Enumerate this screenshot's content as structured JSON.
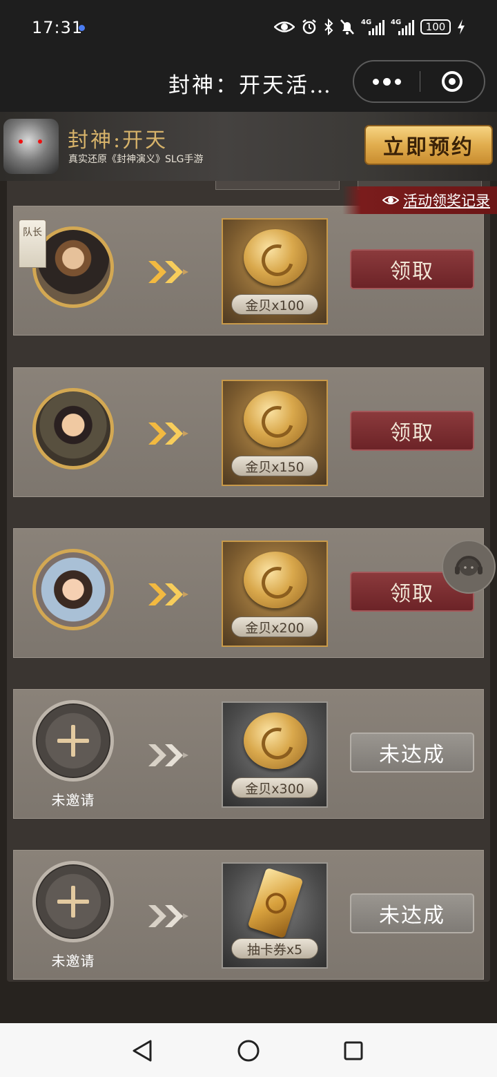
{
  "status_bar": {
    "time": "17:31",
    "icons": [
      "eye-icon",
      "alarm-icon",
      "bluetooth-icon",
      "mute-icon",
      "signal-4g-icon",
      "signal-4g-icon",
      "battery-icon",
      "charging-icon"
    ],
    "network_1": "4G",
    "network_2": "4G",
    "battery": "100"
  },
  "title_bar": {
    "title": "封神：开天活…"
  },
  "banner": {
    "game_title": "封神:开天",
    "subtitle": "真实还原《封神演义》SLG手游",
    "reserve_button": "立即预约"
  },
  "record_link": "活动领奖记录",
  "rows": [
    {
      "slot": "captain",
      "captain_badge": "队长",
      "reward": "金贝x100",
      "reward_icon": "gold-coin-icon",
      "button": "领取",
      "state": "claimable"
    },
    {
      "slot": "friend",
      "reward": "金贝x150",
      "reward_icon": "gold-coin-icon",
      "button": "领取",
      "state": "claimable"
    },
    {
      "slot": "friend",
      "reward": "金贝x200",
      "reward_icon": "gold-coin-icon",
      "button": "领取",
      "state": "claimable"
    },
    {
      "slot": "empty",
      "slot_label": "未邀请",
      "reward": "金贝x300",
      "reward_icon": "gold-coin-icon",
      "button": "未达成",
      "state": "locked"
    },
    {
      "slot": "empty",
      "slot_label": "未邀请",
      "reward": "抽卡券x5",
      "reward_icon": "gacha-ticket-icon",
      "button": "未达成",
      "state": "locked"
    }
  ],
  "colors": {
    "claim_button": "#7a2a2e",
    "locked_button": "#8d8984",
    "avatar_ring": "#d3a853",
    "arrow_active": "#f2b940",
    "arrow_inactive": "#c9c2b8"
  }
}
